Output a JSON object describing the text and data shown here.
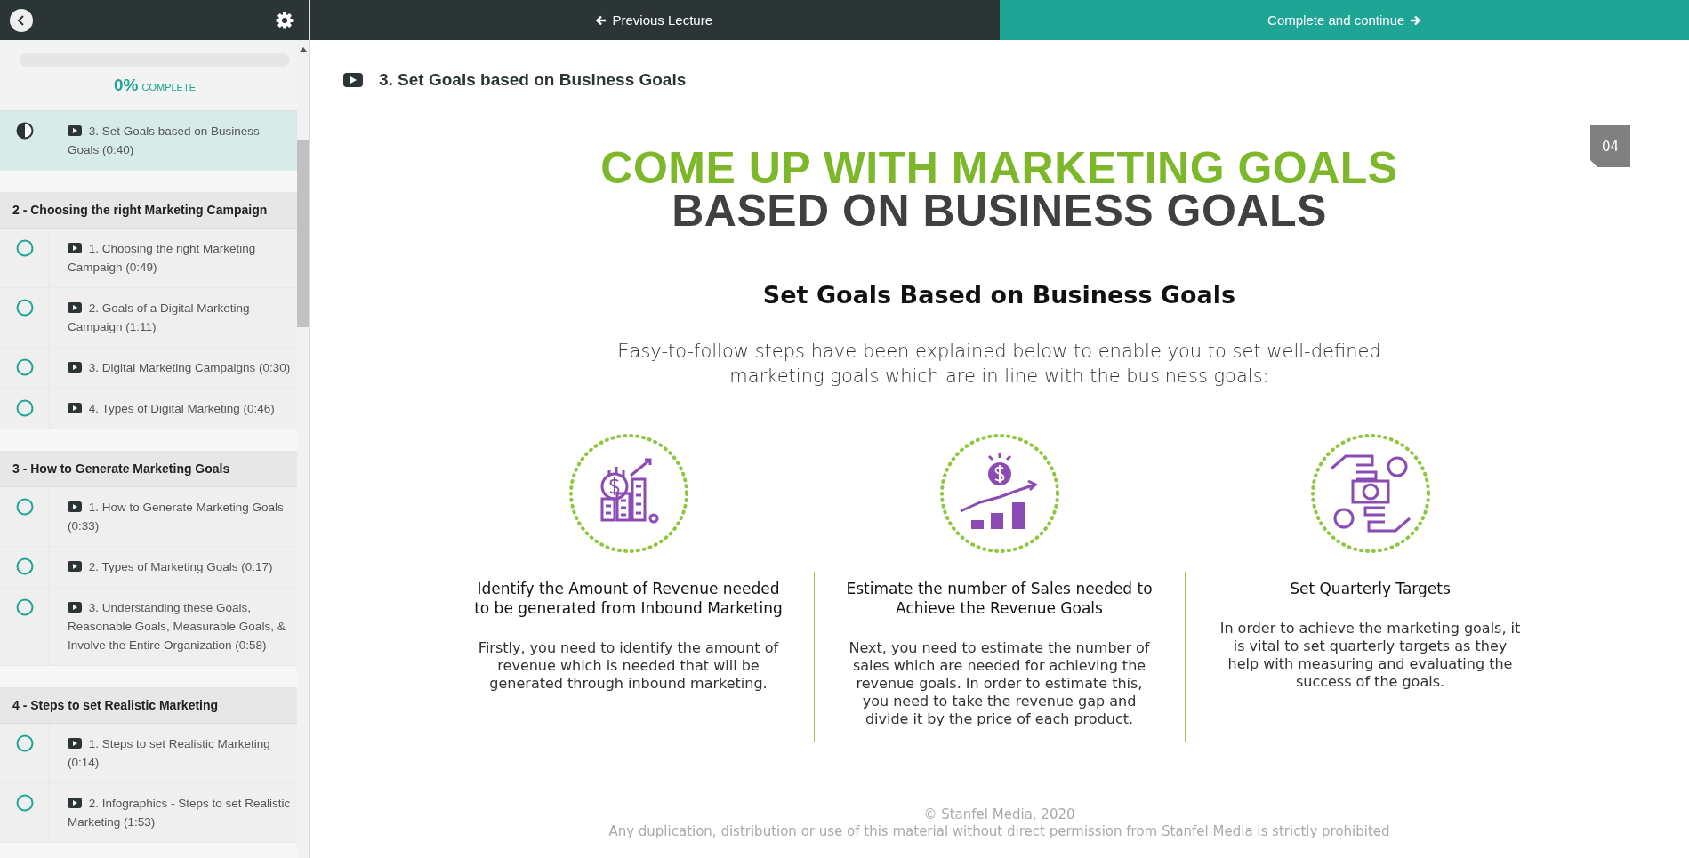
{
  "sidebar": {
    "progress": {
      "percent": "0%",
      "label": "COMPLETE"
    },
    "sections": [
      {
        "lessons": [
          {
            "title": "3. Set Goals based on Business Goals (0:40)",
            "started": true,
            "selected": true
          }
        ]
      },
      {
        "title": "2 - Choosing the right Marketing Campaign",
        "lessons": [
          {
            "title": "1. Choosing the right Marketing Campaign (0:49)",
            "started": false,
            "selected": false
          },
          {
            "title": "2. Goals of a Digital Marketing Campaign (1:11)",
            "started": false,
            "selected": false
          },
          {
            "title": "3. Digital Marketing Campaigns (0:30)",
            "started": false,
            "selected": false
          },
          {
            "title": "4. Types of Digital Marketing (0:46)",
            "started": false,
            "selected": false
          }
        ]
      },
      {
        "title": "3 - How to Generate Marketing Goals",
        "lessons": [
          {
            "title": "1. How to Generate Marketing Goals (0:33)",
            "started": false,
            "selected": false
          },
          {
            "title": "2. Types of Marketing Goals (0:17)",
            "started": false,
            "selected": false
          },
          {
            "title": "3. Understanding these Goals, Reasonable Goals, Measurable Goals, & Involve the Entire Organization (0:58)",
            "started": false,
            "selected": false
          }
        ]
      },
      {
        "title": "4 - Steps to set Realistic Marketing",
        "lessons": [
          {
            "title": "1. Steps to set Realistic Marketing (0:14)",
            "started": false,
            "selected": false
          },
          {
            "title": "2. Infographics - Steps to set Realistic Marketing (1:53)",
            "started": false,
            "selected": false
          }
        ]
      }
    ]
  },
  "nav": {
    "previous": "Previous Lecture",
    "next": "Complete and continue"
  },
  "lecture_title": "3. Set Goals based on Business Goals",
  "slide": {
    "title_line_1": "COME UP WITH MARKETING GOALS",
    "title_line_2": "BASED ON BUSINESS GOALS",
    "page": "04",
    "subtitle": "Set Goals Based on Business Goals",
    "intro": "Easy-to-follow steps have been explained below to enable you to set well-defined marketing goals which are in line with the business goals:",
    "steps": [
      {
        "kind": "revenue",
        "heading": "Identify the Amount of Revenue needed to be generated from Inbound Marketing",
        "body": "Firstly, you need to identify the amount of revenue which is needed that will be generated through inbound marketing."
      },
      {
        "kind": "sales",
        "heading": "Estimate the number of Sales needed to Achieve the Revenue Goals",
        "body": "Next, you need to estimate the number of sales which are needed for achieving the revenue goals. In order to estimate this, you need to take the revenue gap and divide it by the price of each product."
      },
      {
        "kind": "targets",
        "heading": "Set Quarterly Targets",
        "body": "In order to achieve the marketing goals, it is vital to set quarterly targets as they help with measuring and evaluating the success of the goals."
      }
    ],
    "copyright": "© Stanfel Media, 2020",
    "notice": "Any duplication, distribution or use of this material without direct permission from Stanfel Media is strictly prohibited"
  }
}
